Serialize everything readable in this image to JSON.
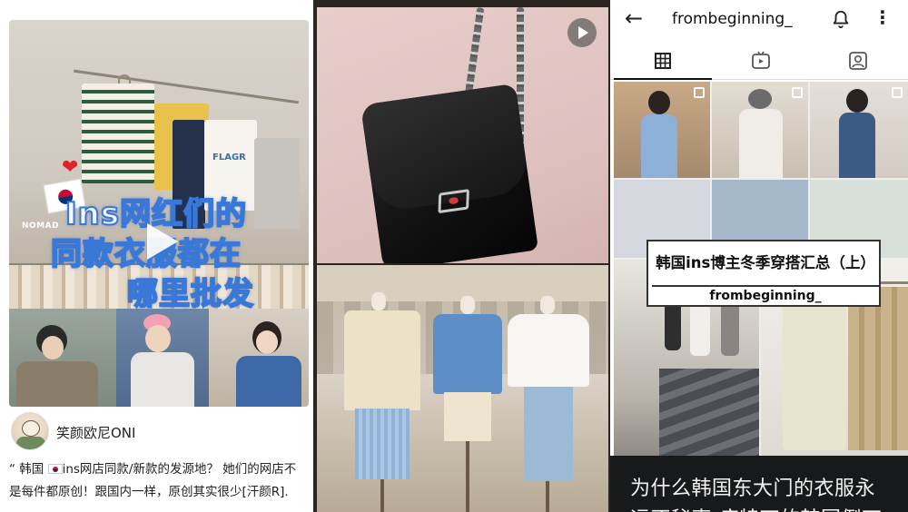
{
  "panel1": {
    "overlay_lines": [
      "Ins网红们的",
      "同款衣服都在",
      "哪里批发"
    ],
    "store_sign": "NOMAD",
    "shirt_print": "FLAGR",
    "author": "笑颜欧尼ONI",
    "caption_line1_a": "“ 韩国",
    "caption_line1_b": "ins网店同款/新款的发源地？ 她们的网店不",
    "caption_line2": "是每件都原创！跟国内一样，原创其实很少[汗颜R]."
  },
  "panel2": {
    "play_icon": "play-icon"
  },
  "panel3": {
    "username": "frombeginning_",
    "banner_title": "韩国ins博主冬季穿搭汇总（上）",
    "banner_handle": "frombeginning_",
    "footer_line1": "为什么韩国东大门的衣服永",
    "footer_line2": "远不秘声 痞特丁的韩国倒丁"
  },
  "colors": {
    "overlay_text_fill": "#f4f8ff",
    "overlay_text_stroke": "#3a78d8",
    "footer_bg": "#18191b"
  }
}
